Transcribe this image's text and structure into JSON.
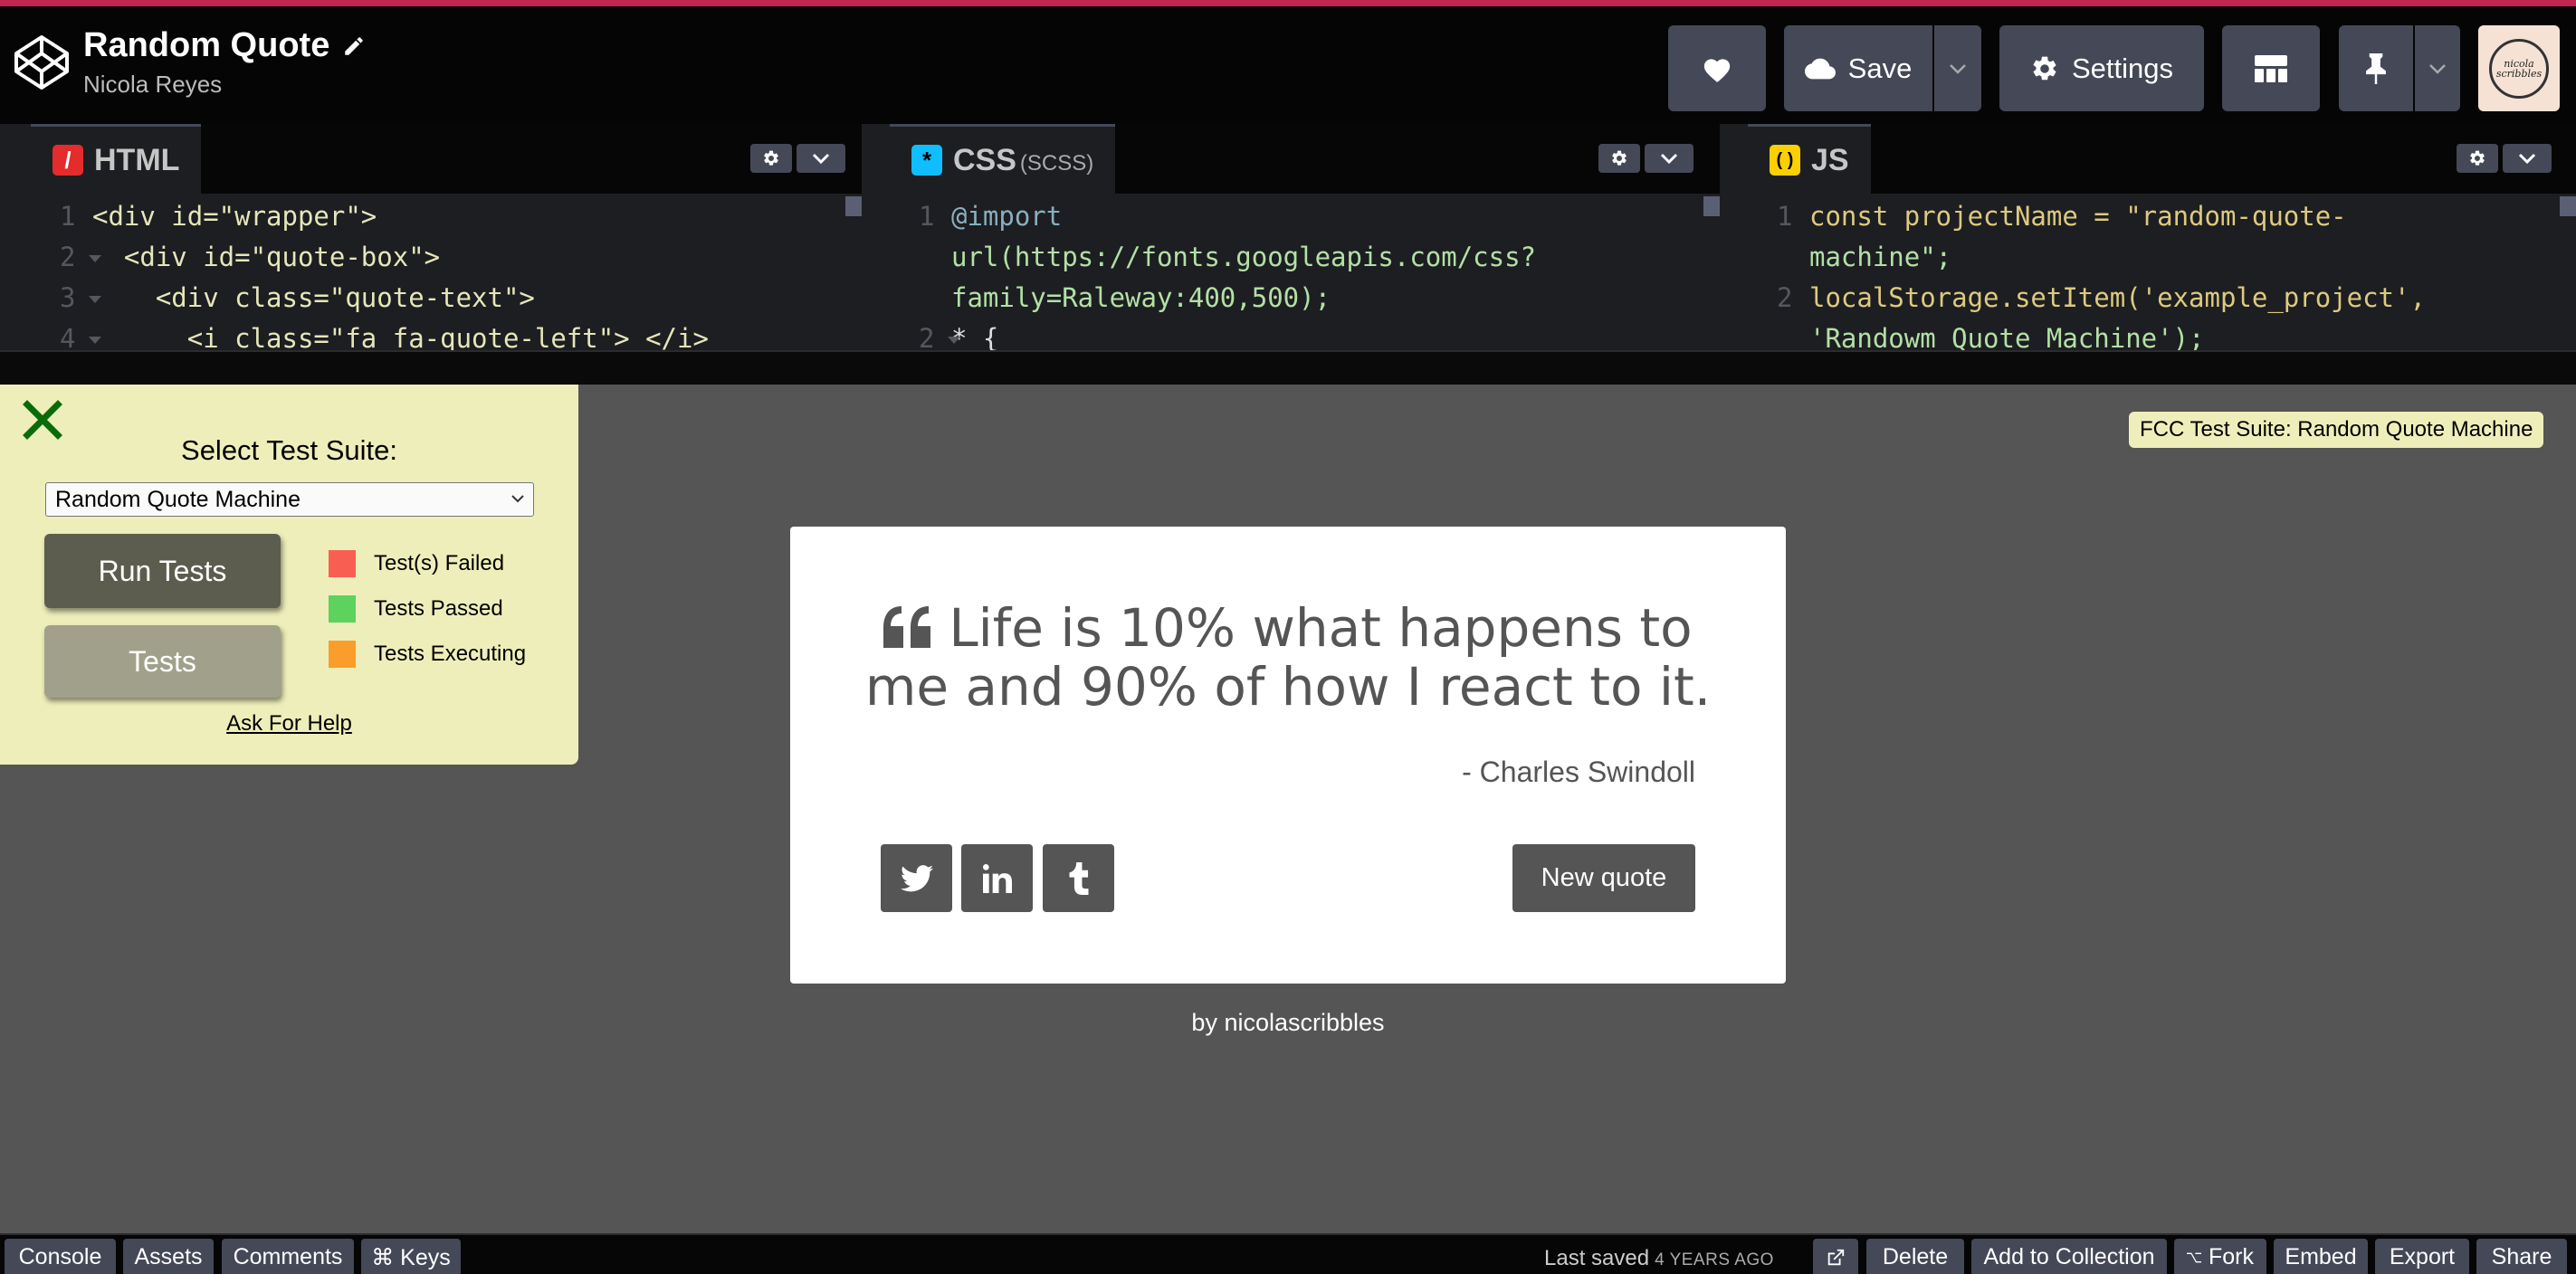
{
  "header": {
    "title": "Random Quote",
    "owner": "Nicola Reyes",
    "save_label": "Save",
    "settings_label": "Settings",
    "avatar_text": "nicola scribbles"
  },
  "editors": {
    "html": {
      "label": "HTML",
      "icon_glyph": "/",
      "lines": [
        {
          "num": "1",
          "code": "<div id=\"wrapper\">"
        },
        {
          "num": "2",
          "code": "  <div id=\"quote-box\">"
        },
        {
          "num": "3",
          "code": "    <div class=\"quote-text\">"
        },
        {
          "num": "4",
          "code": "      <i class=\"fa fa-quote-left\"> </i>"
        }
      ]
    },
    "css": {
      "label": "CSS",
      "sublabel": "(SCSS)",
      "icon_glyph": "*",
      "lines": [
        {
          "num": "1",
          "code": "@import"
        },
        {
          "num": "",
          "code": "url(https://fonts.googleapis.com/css?"
        },
        {
          "num": "",
          "code": "family=Raleway:400,500);"
        },
        {
          "num": "2",
          "code": "* {"
        }
      ]
    },
    "js": {
      "label": "JS",
      "icon_glyph": "( )",
      "lines": [
        {
          "num": "1",
          "code": "const projectName = \"random-quote-"
        },
        {
          "num": "",
          "code": "machine\";"
        },
        {
          "num": "2",
          "code": "localStorage.setItem('example_project',"
        },
        {
          "num": "",
          "code": "'Randowm Quote Machine');"
        }
      ]
    }
  },
  "fcc": {
    "select_label": "Select Test Suite:",
    "selected_suite": "Random Quote Machine",
    "run_tests_label": "Run Tests",
    "tests_label": "Tests",
    "legend": [
      {
        "label": "Test(s) Failed",
        "color": "#f95e52"
      },
      {
        "label": "Tests Passed",
        "color": "#5dd25d"
      },
      {
        "label": "Tests Executing",
        "color": "#fa9d2a"
      }
    ],
    "help_label": "Ask For Help",
    "badge_label": "FCC Test Suite: Random Quote Machine"
  },
  "quote": {
    "text": "Life is 10% what happens to me and 90% of how I react to it.",
    "author": "- Charles Swindoll",
    "new_quote_label": "New quote",
    "byline_prefix": "by",
    "byline_name": "nicolascribbles"
  },
  "footer": {
    "console_label": "Console",
    "assets_label": "Assets",
    "comments_label": "Comments",
    "keys_label": "⌘ Keys",
    "last_saved_label": "Last saved",
    "last_saved_ago": "4 YEARS AGO",
    "delete_label": "Delete",
    "add_collection_label": "Add to Collection",
    "fork_label": "Fork",
    "embed_label": "Embed",
    "export_label": "Export",
    "share_label": "Share"
  },
  "colors": {
    "accent_bar": "#c0264f",
    "button_bg": "#444857",
    "preview_bg": "#555555",
    "fcc_panel_bg": "#eeeeba"
  }
}
